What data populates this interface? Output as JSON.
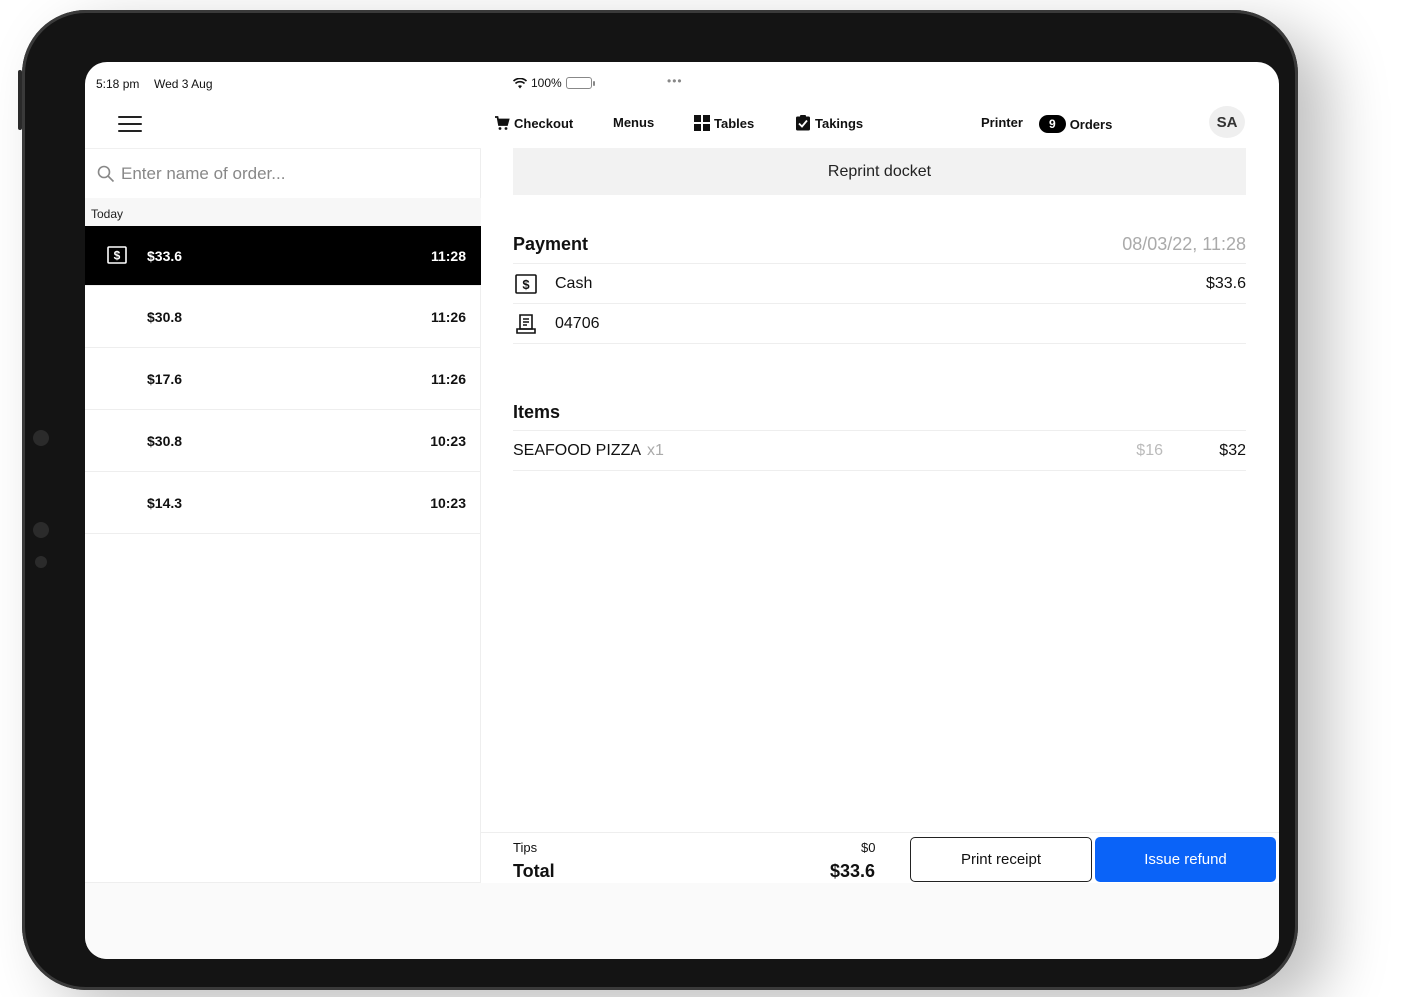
{
  "status_bar": {
    "time": "5:18 pm",
    "date": "Wed 3 Aug",
    "multitask": "•••",
    "battery_percent": "100%",
    "wifi_icon": "wifi-icon",
    "battery_icon": "battery-charging-icon"
  },
  "nav": {
    "menu_icon": "hamburger-menu-icon",
    "checkout": "Checkout",
    "menus": "Menus",
    "tables": "Tables",
    "takings": "Takings",
    "printer": "Printer",
    "orders_count": "9",
    "orders": "Orders",
    "avatar_initials": "SA"
  },
  "search": {
    "placeholder": "Enter name of order..."
  },
  "orders_list": {
    "section": "Today",
    "items": [
      {
        "amount": "$33.6",
        "time": "11:28",
        "active": true,
        "icon": "cash-icon"
      },
      {
        "amount": "$30.8",
        "time": "11:26"
      },
      {
        "amount": "$17.6",
        "time": "11:26"
      },
      {
        "amount": "$30.8",
        "time": "10:23"
      },
      {
        "amount": "$14.3",
        "time": "10:23"
      }
    ]
  },
  "detail": {
    "reprint_label": "Reprint docket",
    "payment_title": "Payment",
    "payment_datetime": "08/03/22, 11:28",
    "payment_method": "Cash",
    "payment_amount": "$33.6",
    "receipt_number": "04706",
    "items_title": "Items",
    "items": [
      {
        "name": "SEAFOOD PIZZA",
        "qty": "x1",
        "unit_price": "$16",
        "total": "$32"
      }
    ]
  },
  "footer": {
    "tips_label": "Tips",
    "tips_value": "$0",
    "total_label": "Total",
    "total_value": "$33.6",
    "print_receipt": "Print receipt",
    "issue_refund": "Issue refund"
  },
  "colors": {
    "accent": "#0a63f8",
    "active_row": "#000000",
    "battery": "#30d158"
  }
}
